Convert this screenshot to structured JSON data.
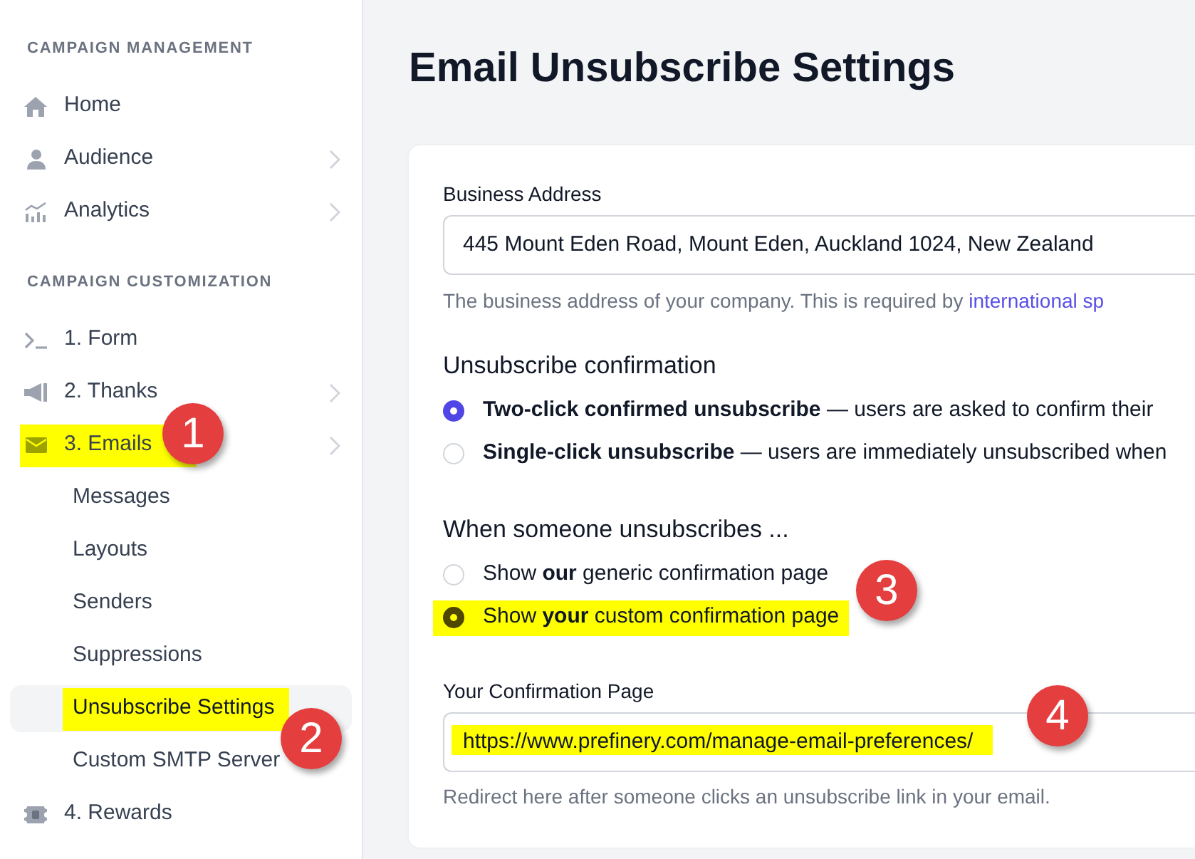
{
  "sidebar": {
    "sections": [
      {
        "heading": "CAMPAIGN MANAGEMENT",
        "items": [
          {
            "label": "Home",
            "expandable": false,
            "selected": false,
            "highlighted": false
          },
          {
            "label": "Audience",
            "expandable": true,
            "selected": false,
            "highlighted": false
          },
          {
            "label": "Analytics",
            "expandable": true,
            "selected": false,
            "highlighted": false
          }
        ]
      },
      {
        "heading": "CAMPAIGN CUSTOMIZATION",
        "items": [
          {
            "label": "1. Form",
            "expandable": false,
            "selected": false,
            "highlighted": false
          },
          {
            "label": "2. Thanks",
            "expandable": true,
            "selected": false,
            "highlighted": false
          },
          {
            "label": "3. Emails",
            "expandable": true,
            "selected": false,
            "highlighted": true,
            "callout": "1",
            "children": [
              {
                "label": "Messages",
                "selected": false,
                "highlighted": false
              },
              {
                "label": "Layouts",
                "selected": false,
                "highlighted": false
              },
              {
                "label": "Senders",
                "selected": false,
                "highlighted": false
              },
              {
                "label": "Suppressions",
                "selected": false,
                "highlighted": false
              },
              {
                "label": "Unsubscribe Settings",
                "selected": true,
                "highlighted": true,
                "callout": "2"
              },
              {
                "label": "Custom SMTP Server",
                "selected": false,
                "highlighted": false
              }
            ]
          },
          {
            "label": "4. Rewards",
            "expandable": false,
            "selected": false,
            "highlighted": false
          }
        ]
      }
    ]
  },
  "page": {
    "title": "Email Unsubscribe Settings"
  },
  "business_address": {
    "label": "Business Address",
    "value": "445 Mount Eden Road, Mount Eden, Auckland 1024, New Zealand",
    "help": "The business address of your company. This is required by ",
    "help_link": "international sp"
  },
  "unsubscribe_confirmation": {
    "heading": "Unsubscribe confirmation",
    "options": [
      {
        "text": "**Two-click confirmed unsubscribe** — users are asked to confirm their",
        "selected": true,
        "highlighted": false
      },
      {
        "text": "**Single-click unsubscribe** — users are immediately unsubscribed when",
        "selected": false,
        "highlighted": false
      }
    ]
  },
  "when_unsubscribes": {
    "heading": "When someone unsubscribes ...",
    "options": [
      {
        "text": "Show **our** generic confirmation page",
        "selected": false,
        "highlighted": false
      },
      {
        "text": "Show **your** custom confirmation page",
        "selected": true,
        "highlighted": true,
        "callout": "3"
      }
    ]
  },
  "confirmation_page": {
    "label": "Your Confirmation Page",
    "value": "https://www.prefinery.com/manage-email-preferences/",
    "highlighted": true,
    "callout": "4",
    "help": "Redirect here after someone clicks an unsubscribe link in your email."
  }
}
